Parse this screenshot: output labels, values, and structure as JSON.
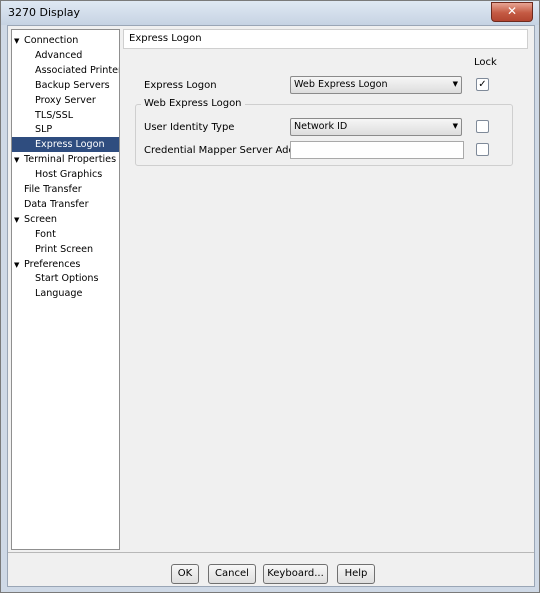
{
  "window": {
    "title": "3270 Display",
    "close_glyph": "✕"
  },
  "tree": {
    "items": [
      {
        "label": "Connection",
        "arrow": "▼",
        "selected": false
      },
      {
        "label": "Advanced",
        "arrow": "",
        "selected": false
      },
      {
        "label": "Associated Printer",
        "arrow": "",
        "selected": false
      },
      {
        "label": "Backup Servers",
        "arrow": "",
        "selected": false
      },
      {
        "label": "Proxy Server",
        "arrow": "",
        "selected": false
      },
      {
        "label": "TLS/SSL",
        "arrow": "",
        "selected": false
      },
      {
        "label": "SLP",
        "arrow": "",
        "selected": false
      },
      {
        "label": "Express Logon",
        "arrow": "",
        "selected": true
      },
      {
        "label": "Terminal Properties",
        "arrow": "▼",
        "selected": false
      },
      {
        "label": "Host Graphics",
        "arrow": "",
        "selected": false
      },
      {
        "label": "File Transfer",
        "arrow": "",
        "selected": false
      },
      {
        "label": "Data Transfer",
        "arrow": "",
        "selected": false
      },
      {
        "label": "Screen",
        "arrow": "▼",
        "selected": false
      },
      {
        "label": "Font",
        "arrow": "",
        "selected": false
      },
      {
        "label": "Print Screen",
        "arrow": "",
        "selected": false
      },
      {
        "label": "Preferences",
        "arrow": "▼",
        "selected": false
      },
      {
        "label": "Start Options",
        "arrow": "",
        "selected": false
      },
      {
        "label": "Language",
        "arrow": "",
        "selected": false
      }
    ]
  },
  "panel": {
    "header": "Express Logon",
    "lock_label": "Lock",
    "express_logon": {
      "label": "Express Logon",
      "value": "Web Express Logon",
      "lock_checked": true
    },
    "group_title": "Web Express Logon",
    "user_identity": {
      "label": "User Identity Type",
      "value": "Network ID",
      "lock_checked": false
    },
    "credential_mapper": {
      "label": "Credential Mapper Server Address",
      "value": "",
      "lock_checked": false
    },
    "dropdown_glyph": "▼",
    "check_glyph": "✓"
  },
  "buttons": {
    "ok": "OK",
    "cancel": "Cancel",
    "keyboard": "Keyboard...",
    "help": "Help"
  }
}
